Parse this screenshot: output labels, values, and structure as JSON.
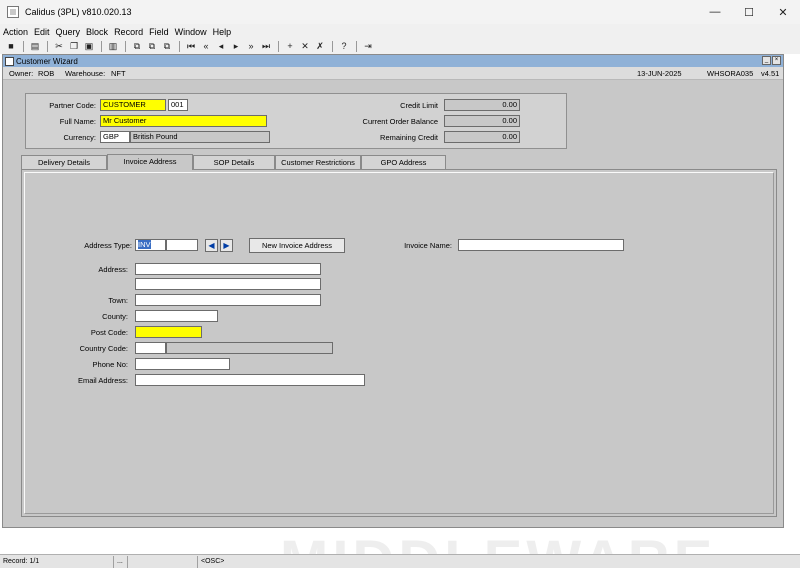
{
  "window": {
    "title": "Calidus (3PL) v810.020.13",
    "controls": {
      "minimize": "—",
      "maximize": "☐",
      "close": "✕"
    }
  },
  "menu": [
    "Action",
    "Edit",
    "Query",
    "Block",
    "Record",
    "Field",
    "Window",
    "Help"
  ],
  "toolbar": {
    "icons": [
      "save-icon",
      "print-icon",
      "cut-icon",
      "copy-icon",
      "paste-icon",
      "clear-icon",
      "duplicate-icon",
      "copy-record-icon",
      "paste-record-icon",
      "first-record-icon",
      "previous-block-icon",
      "previous-record-icon",
      "next-record-icon",
      "next-block-icon",
      "last-record-icon",
      "insert-record-icon",
      "delete-record-icon",
      "remove-icon",
      "help-icon",
      "exit-icon"
    ],
    "glyphs": [
      "■",
      "▤",
      "✂",
      "❐",
      "▣",
      "▥",
      "⧉",
      "⧉",
      "⧉",
      "⏮",
      "«",
      "◂",
      "▸",
      "»",
      "⏭",
      "+",
      "✕",
      "✗",
      "?",
      "⇥"
    ]
  },
  "wizard": {
    "title": "Customer Wizard",
    "owner_label": "Owner:",
    "owner_value": "ROB",
    "warehouse_label": "Warehouse:",
    "warehouse_value": "NFT",
    "date": "13-JUN-2025",
    "form_id": "WHSORA035",
    "version": "v4.51",
    "ctrl_min": "_",
    "ctrl_max": "×"
  },
  "header": {
    "partner_code_label": "Partner Code:",
    "partner_code": "CUSTOMER",
    "partner_suffix": "001",
    "full_name_label": "Full Name:",
    "full_name": "Mr Customer",
    "currency_label": "Currency:",
    "currency_code": "GBP",
    "currency_name": "British Pound",
    "credit_limit_label": "Credit Limit",
    "credit_limit": "0.00",
    "order_balance_label": "Current Order Balance",
    "order_balance": "0.00",
    "remaining_credit_label": "Remaining Credit",
    "remaining_credit": "0.00"
  },
  "tabs": [
    "Delivery Details",
    "Invoice Address",
    "SOP Details",
    "Customer Restrictions",
    "GPO Address"
  ],
  "active_tab": "Invoice Address",
  "invoice": {
    "address_type_label": "Address Type:",
    "address_type": "INV",
    "address_type_extra": "",
    "prev_glyph": "◀",
    "next_glyph": "▶",
    "new_button": "New Invoice Address",
    "invoice_name_label": "Invoice Name:",
    "invoice_name": "",
    "address_label": "Address:",
    "address_line1": "",
    "address_line2": "",
    "town_label": "Town:",
    "town": "",
    "county_label": "County:",
    "county": "",
    "post_code_label": "Post Code:",
    "post_code": "",
    "country_code_label": "Country Code:",
    "country_code": "",
    "country_name": "",
    "phone_label": "Phone No:",
    "phone": "",
    "email_label": "Email Address:",
    "email": ""
  },
  "watermark": "MIDDLEWARE",
  "status": {
    "record": "Record: 1/1",
    "dots": "...",
    "osc": "<OSC>"
  },
  "colors": {
    "mandatory": "#ffff00",
    "wizard_title": "#8fb1d7",
    "panel": "#c8c8c8",
    "selection": "#3a6ec4"
  }
}
